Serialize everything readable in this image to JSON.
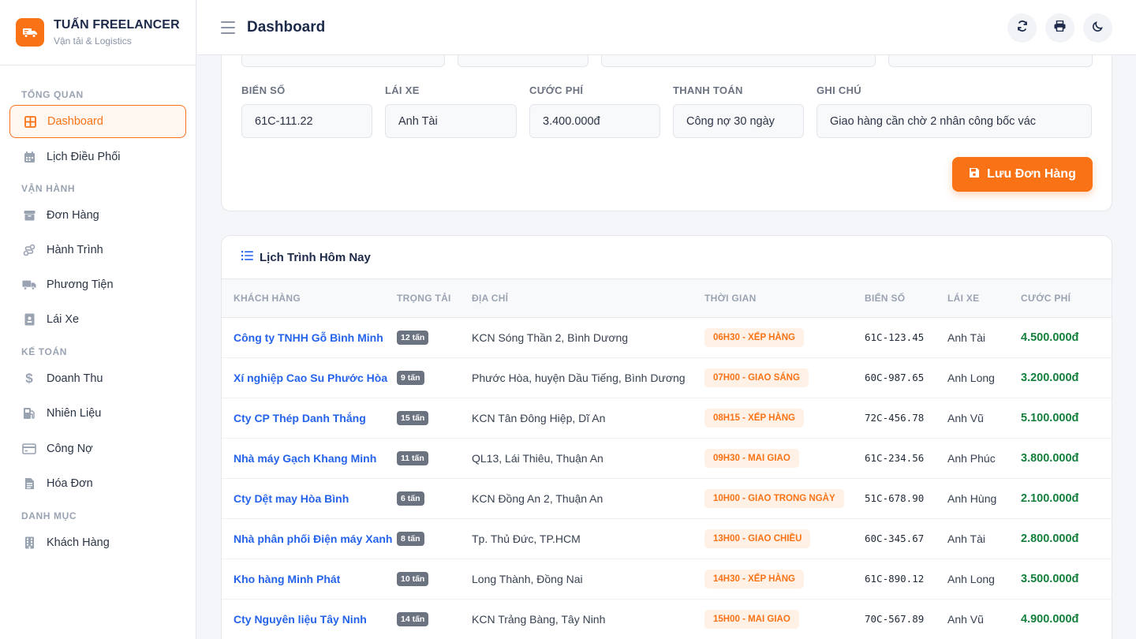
{
  "brand": {
    "name": "TUẤN FREELANCER",
    "subtitle": "Vận tải & Logistics"
  },
  "sidebar": {
    "sections": [
      {
        "title": "TỔNG QUAN"
      },
      {
        "title": "VẬN HÀNH"
      },
      {
        "title": "KẾ TOÁN"
      },
      {
        "title": "DANH MỤC"
      }
    ],
    "items": [
      {
        "label": "Dashboard",
        "icon": "grid-icon",
        "active": true
      },
      {
        "label": "Lịch Điều Phối",
        "icon": "calendar-icon"
      },
      {
        "label": "Đơn Hàng",
        "icon": "box-icon"
      },
      {
        "label": "Hành Trình",
        "icon": "route-icon"
      },
      {
        "label": "Phương Tiện",
        "icon": "truck-icon"
      },
      {
        "label": "Lái Xe",
        "icon": "id-badge-icon"
      },
      {
        "label": "Doanh Thu",
        "icon": "dollar-icon"
      },
      {
        "label": "Nhiên Liệu",
        "icon": "fuel-icon"
      },
      {
        "label": "Công Nợ",
        "icon": "credit-card-icon"
      },
      {
        "label": "Hóa Đơn",
        "icon": "invoice-icon"
      },
      {
        "label": "Khách Hàng",
        "icon": "building-icon"
      }
    ]
  },
  "header": {
    "title": "Dashboard",
    "actions": [
      "refresh-icon",
      "print-icon",
      "moon-icon"
    ]
  },
  "form": {
    "fields": [
      {
        "label": "BIỂN SỐ",
        "value": "61C-111.22"
      },
      {
        "label": "LÁI XE",
        "value": "Anh Tài"
      },
      {
        "label": "CƯỚC PHÍ",
        "value": "3.400.000đ"
      },
      {
        "label": "THANH TOÁN",
        "value": "Công nợ 30 ngày"
      },
      {
        "label": "GHI CHÚ",
        "value": "Giao hàng cần chờ 2 nhân công bốc vác"
      }
    ],
    "save_label": "Lưu Đơn Hàng"
  },
  "schedule": {
    "title": "Lịch Trình Hôm Nay",
    "columns": [
      "KHÁCH HÀNG",
      "TRỌNG TẢI",
      "ĐỊA CHỈ",
      "THỜI GIAN",
      "BIỂN SỐ",
      "LÁI XE",
      "CƯỚC PHÍ"
    ],
    "rows": [
      {
        "customer": "Công ty TNHH Gỗ Bình Minh",
        "load": "12 tấn",
        "address": "KCN Sóng Thần 2, Bình Dương",
        "time": "06H30 - XẾP HÀNG",
        "plate": "61C-123.45",
        "driver": "Anh Tài",
        "fee": "4.500.000đ"
      },
      {
        "customer": "Xí nghiệp Cao Su Phước Hòa",
        "load": "9 tấn",
        "address": "Phước Hòa, huyện Dầu Tiếng, Bình Dương",
        "time": "07H00 - GIAO SÁNG",
        "plate": "60C-987.65",
        "driver": "Anh Long",
        "fee": "3.200.000đ"
      },
      {
        "customer": "Cty CP Thép Danh Thắng",
        "load": "15 tấn",
        "address": "KCN Tân Đông Hiệp, Dĩ An",
        "time": "08H15 - XẾP HÀNG",
        "plate": "72C-456.78",
        "driver": "Anh Vũ",
        "fee": "5.100.000đ"
      },
      {
        "customer": "Nhà máy Gạch Khang Minh",
        "load": "11 tấn",
        "address": "QL13, Lái Thiêu, Thuận An",
        "time": "09H30 - MAI GIAO",
        "plate": "61C-234.56",
        "driver": "Anh Phúc",
        "fee": "3.800.000đ"
      },
      {
        "customer": "Cty Dệt may Hòa Bình",
        "load": "6 tấn",
        "address": "KCN Đồng An 2, Thuận An",
        "time": "10H00 - GIAO TRONG NGÀY",
        "plate": "51C-678.90",
        "driver": "Anh Hùng",
        "fee": "2.100.000đ"
      },
      {
        "customer": "Nhà phân phối Điện máy Xanh",
        "load": "8 tấn",
        "address": "Tp. Thủ Đức, TP.HCM",
        "time": "13H00 - GIAO CHIỀU",
        "plate": "60C-345.67",
        "driver": "Anh Tài",
        "fee": "2.800.000đ"
      },
      {
        "customer": "Kho hàng Minh Phát",
        "load": "10 tấn",
        "address": "Long Thành, Đồng Nai",
        "time": "14H30 - XẾP HÀNG",
        "plate": "61C-890.12",
        "driver": "Anh Long",
        "fee": "3.500.000đ"
      },
      {
        "customer": "Cty Nguyên liệu Tây Ninh",
        "load": "14 tấn",
        "address": "KCN Trảng Bàng, Tây Ninh",
        "time": "15H00 - MAI GIAO",
        "plate": "70C-567.89",
        "driver": "Anh Vũ",
        "fee": "4.900.000đ"
      }
    ]
  },
  "colors": {
    "accent": "#f97316",
    "link": "#2563eb",
    "money": "#15803d"
  }
}
